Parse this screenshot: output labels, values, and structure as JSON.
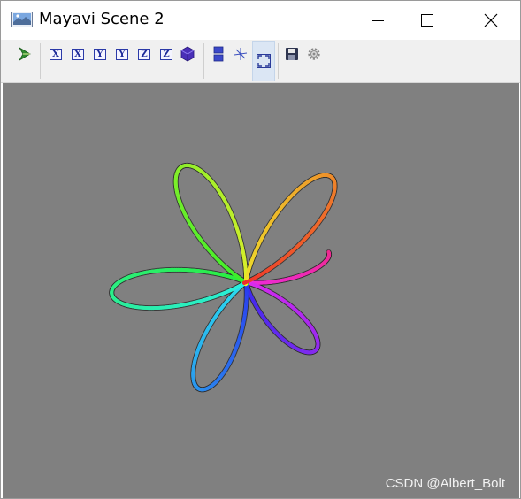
{
  "window": {
    "title": "Mayavi Scene 2",
    "controls": [
      "minimize-icon",
      "maximize-icon",
      "close-icon"
    ]
  },
  "toolbar": {
    "buttons": [
      {
        "name": "mayavi-pipeline-button",
        "icon": "mayavi-logo-icon"
      },
      {
        "name": "view-x-pos-button",
        "label": "X"
      },
      {
        "name": "view-x-neg-button",
        "label": "X"
      },
      {
        "name": "view-y-pos-button",
        "label": "Y"
      },
      {
        "name": "view-y-neg-button",
        "label": "Y"
      },
      {
        "name": "view-z-pos-button",
        "label": "Z"
      },
      {
        "name": "view-z-neg-button",
        "label": "Z"
      },
      {
        "name": "isometric-view-button",
        "icon": "cube-icon"
      },
      {
        "name": "parallel-projection-button",
        "icon": "parallel-icon"
      },
      {
        "name": "axes-toggle-button",
        "icon": "axes-icon"
      },
      {
        "name": "full-screen-button",
        "icon": "fullscreen-icon",
        "active": true
      },
      {
        "name": "save-button",
        "icon": "floppy-disk-icon"
      },
      {
        "name": "configure-button",
        "icon": "gear-icon"
      }
    ]
  },
  "scene": {
    "background": "#808080",
    "watermark": "CSDN @Albert_Bolt"
  },
  "colors": {
    "accent_blue": "#2b3aa8",
    "toolbar_bg": "#f0f0f0",
    "active_bg": "#dbe6f4"
  }
}
